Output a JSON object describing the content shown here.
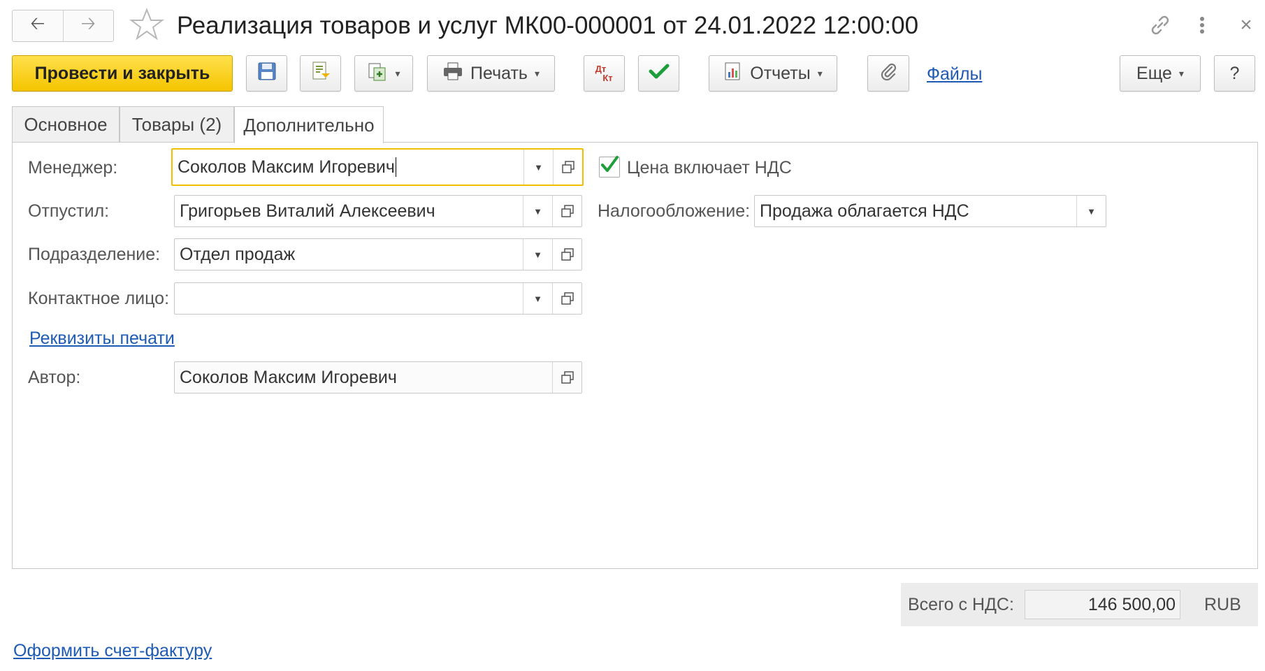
{
  "window": {
    "title": "Реализация товаров и услуг МК00-000001 от 24.01.2022 12:00:00"
  },
  "toolbar": {
    "post_close_label": "Провести и закрыть",
    "print_label": "Печать",
    "dtkt_top": "Дт",
    "dtkt_bottom": "Кт",
    "reports_label": "Отчеты",
    "files_label": "Файлы",
    "more_label": "Еще",
    "help_label": "?"
  },
  "tabs": [
    {
      "label": "Основное"
    },
    {
      "label": "Товары (2)"
    },
    {
      "label": "Дополнительно"
    }
  ],
  "form": {
    "manager": {
      "label": "Менеджер:",
      "value": "Соколов Максим Игоревич"
    },
    "released": {
      "label": "Отпустил:",
      "value": "Григорьев Виталий Алексеевич"
    },
    "department": {
      "label": "Подразделение:",
      "value": "Отдел продаж"
    },
    "contact": {
      "label": "Контактное лицо:",
      "value": ""
    },
    "print_details_link": "Реквизиты печати",
    "author": {
      "label": "Автор:",
      "value": "Соколов Максим Игоревич"
    },
    "vat_included": {
      "label": "Цена включает НДС",
      "checked": true
    },
    "taxation": {
      "label": "Налогообложение:",
      "value": "Продажа облагается НДС"
    }
  },
  "footer": {
    "total_label": "Всего с НДС:",
    "total_value": "146 500,00",
    "currency": "RUB",
    "invoice_link": "Оформить счет-фактуру"
  },
  "colors": {
    "primary_button": "#f5c400",
    "link": "#1e5bb5",
    "check": "#1e9e3a",
    "focus_border": "#f0c000"
  }
}
